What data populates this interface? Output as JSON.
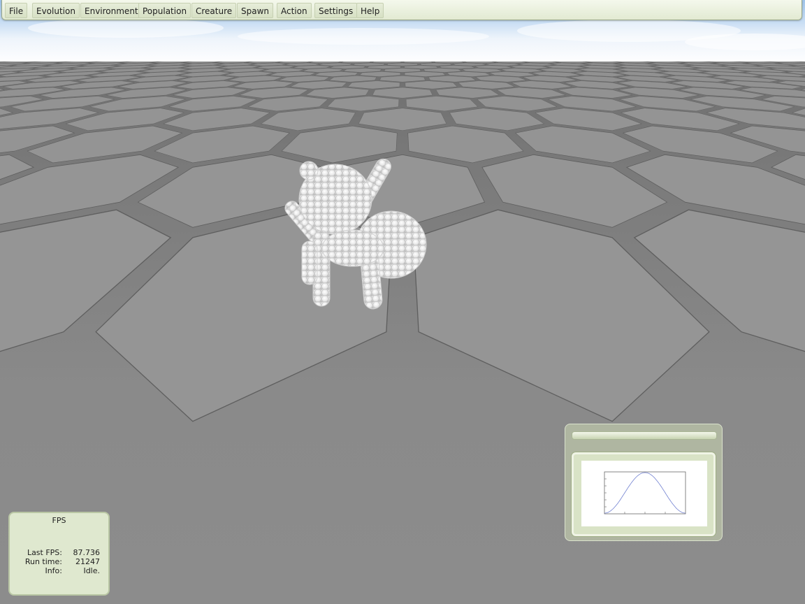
{
  "menubar": {
    "items": [
      "File",
      "Evolution",
      "Environment",
      "Population",
      "Creature",
      "Spawn",
      "Action",
      "Settings",
      "Help"
    ]
  },
  "fps_panel": {
    "title": "FPS",
    "rows": [
      {
        "label": "Last FPS:",
        "value": "87.736"
      },
      {
        "label": "Run time:",
        "value": "21247"
      },
      {
        "label": "Info:",
        "value": "Idle."
      }
    ]
  },
  "graph_window": {
    "title": "",
    "plot": {
      "type": "line",
      "color": "#6f7fd0"
    }
  },
  "scene": {
    "creature": "white mesh creature",
    "ground_color": "#808080",
    "sky_color": "#b9d4f0"
  }
}
